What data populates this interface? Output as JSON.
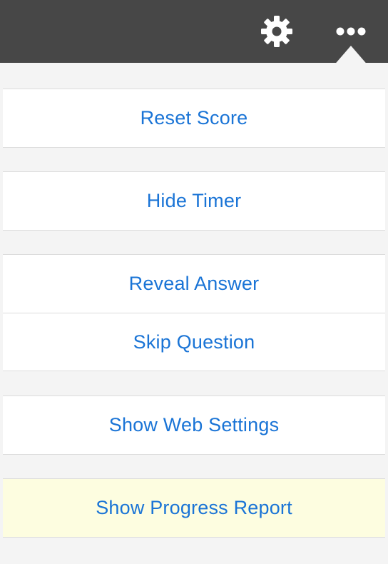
{
  "toolbar": {
    "settings_icon": "gear-icon",
    "more_icon": "more-dots-icon",
    "icon_color": "#ffffff",
    "background_color": "#474747"
  },
  "menu": {
    "link_color": "#1a74d6",
    "highlight_color": "#fdfde0",
    "items": [
      {
        "label": "Reset Score"
      },
      {
        "label": "Hide Timer"
      },
      {
        "label": "Reveal Answer"
      },
      {
        "label": "Skip Question"
      },
      {
        "label": "Show Web Settings"
      },
      {
        "label": "Show Progress Report",
        "highlighted": true
      }
    ]
  }
}
